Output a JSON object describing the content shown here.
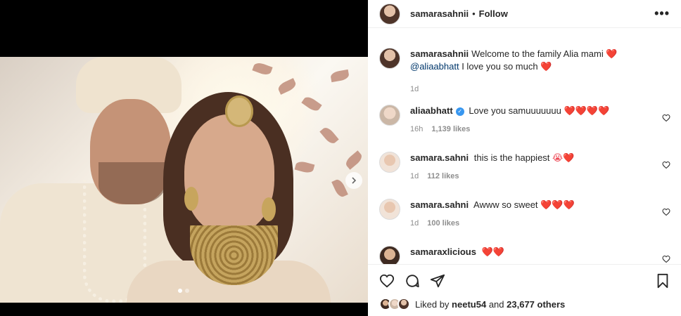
{
  "post": {
    "owner": "samarasahnii",
    "follow_label": "Follow",
    "bullet": "•",
    "more_label": "•••"
  },
  "caption": {
    "username": "samarasahnii",
    "text_before": "Welcome to the family Alia mami",
    "mention": "@aliaabhatt",
    "text_after": "I love you so much",
    "time": "1d"
  },
  "comments": [
    {
      "username": "aliaabhatt",
      "verified": true,
      "text": "Love you samuuuuuuu",
      "emoji": "❤️❤️❤️❤️",
      "time": "16h",
      "likes": "1,139 likes"
    },
    {
      "username": "samara.sahni",
      "verified": false,
      "text": "this is the happiest",
      "emoji": "😭❤️",
      "time": "1d",
      "likes": "112 likes"
    },
    {
      "username": "samara.sahni",
      "verified": false,
      "text": "Awww so sweet",
      "emoji": "❤️❤️❤️",
      "time": "1d",
      "likes": "100 likes"
    },
    {
      "username": "samaraxlicious",
      "verified": false,
      "text": "",
      "emoji": "❤️❤️",
      "time": "",
      "likes": ""
    }
  ],
  "likes_summary": {
    "prefix": "Liked by",
    "user": "neetu54",
    "connector": "and",
    "others": "23,677 others"
  },
  "carousel": {
    "slide_count": 2,
    "active_index": 0
  },
  "colors": {
    "heart": "#ed4956",
    "verified": "#3897f0",
    "mention": "#00376b",
    "meta": "#8e8e8e"
  }
}
